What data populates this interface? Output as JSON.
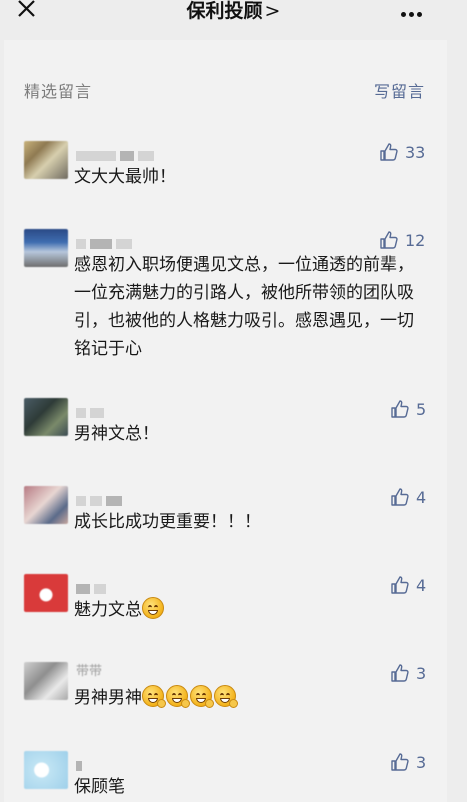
{
  "header": {
    "title": "保利投顾",
    "title_chevron": ">",
    "close_icon": "close-icon",
    "more_icon": "more-icon"
  },
  "section": {
    "label": "精选留言",
    "write_label": "写留言"
  },
  "colors": {
    "link": "#576b95",
    "background": "#ededed",
    "card": "#f2f2f2"
  },
  "comments": [
    {
      "text": "文大大最帅！",
      "likes": "33"
    },
    {
      "text": "感恩初入职场便遇见文总，一位通透的前辈，一位充满魅力的引路人，被他所带领的团队吸引，也被他的人格魅力吸引。感恩遇见，一切铭记于心",
      "likes": "12"
    },
    {
      "text": "男神文总！",
      "likes": "5"
    },
    {
      "text": "成长比成功更重要！！！",
      "likes": "4"
    },
    {
      "text": "魅力文总",
      "likes": "4",
      "emoji": "grinning-emoji"
    },
    {
      "nick": "带带",
      "text": "男神男神",
      "likes": "3",
      "emoji": "hugging-emoji"
    },
    {
      "text": "保顾笔",
      "likes": "3"
    }
  ]
}
